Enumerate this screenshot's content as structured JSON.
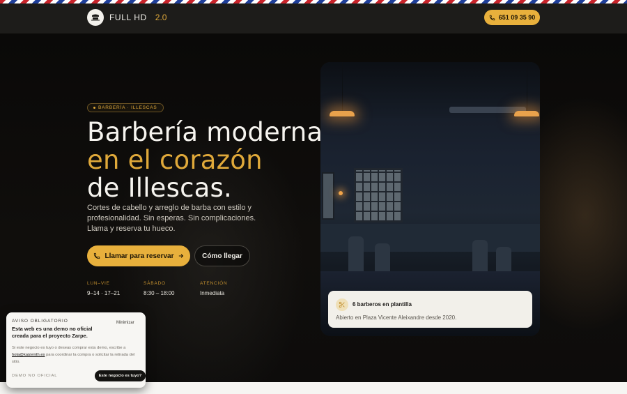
{
  "colors": {
    "accent": "#e0a93a",
    "button": "#e8b03c",
    "dark": "#0b0a09",
    "card": "#f2f0ea"
  },
  "header": {
    "logo_icon": "barber-logo-icon",
    "brand_name": "FULL HD",
    "brand_version": "2.0",
    "phone_icon": "phone-icon",
    "phone_label": "651 09 35 90"
  },
  "hero": {
    "tag": "BARBERÍA · ILLESCAS",
    "title_line1": "Barbería moderna",
    "title_line2": "en el corazón",
    "title_line3": "de Illescas.",
    "lead": "Cortes de cabello y arreglo de barba con estilo y profesionalidad. Sin esperas. Sin complicaciones. Llama y reserva tu hueco.",
    "cta_primary": "Llamar para reservar",
    "cta_primary_icon": "phone-icon",
    "cta_primary_arrow": "arrow-right-icon",
    "cta_secondary": "Cómo llegar",
    "hours": [
      {
        "label": "LUN–VIE",
        "value": "9–14 · 17–21"
      },
      {
        "label": "SÁBADO",
        "value": "8:30 – 18:00"
      },
      {
        "label": "ATENCIÓN",
        "value": "Inmediata"
      }
    ]
  },
  "card": {
    "icon": "scissors-icon",
    "title": "6 barberos en plantilla",
    "subtitle": "Abierto en Plaza Vicente Aleixandre desde 2020."
  },
  "notice": {
    "kicker": "AVISO OBLIGATORIO",
    "minimize": "Minimizar",
    "title": "Esta web es una demo no oficial creada para el proyecto Zarpe.",
    "body_before": "Si este negocio es tuyo o deseas comprar esta demo, escribe a ",
    "email": "hola@kaizenith.es",
    "body_after": " para coordinar la compra o solicitar la retirada del sitio.",
    "footer": "DEMO NO OFICIAL",
    "button": "Este negocio es tuyo?"
  }
}
